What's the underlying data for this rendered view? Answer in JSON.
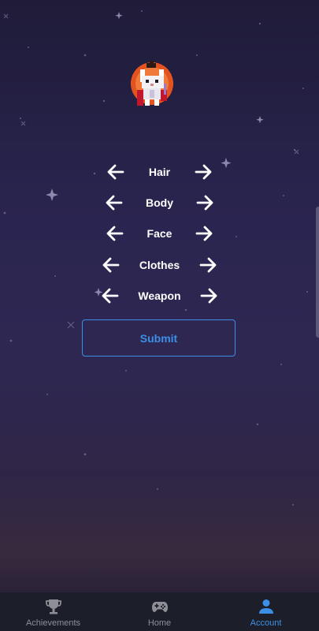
{
  "character": {
    "options": [
      {
        "label": "Hair"
      },
      {
        "label": "Body"
      },
      {
        "label": "Face"
      },
      {
        "label": "Clothes"
      },
      {
        "label": "Weapon"
      }
    ]
  },
  "submit_label": "Submit",
  "nav": {
    "items": [
      {
        "label": "Achievements",
        "icon": "trophy-icon",
        "active": false
      },
      {
        "label": "Home",
        "icon": "gamepad-icon",
        "active": false
      },
      {
        "label": "Account",
        "icon": "person-icon",
        "active": true
      }
    ]
  },
  "colors": {
    "accent": "#3d8fe6",
    "nav_background": "#1c1f2a",
    "inactive": "#8e8e96"
  }
}
